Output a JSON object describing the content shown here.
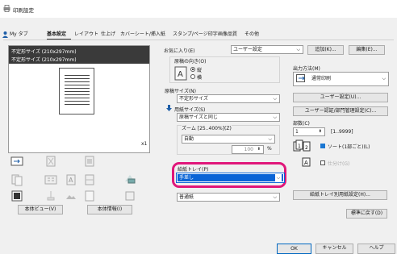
{
  "window": {
    "title": "印刷設定"
  },
  "tabs": [
    "My タブ",
    "基本設定",
    "レイアウト",
    "仕上げ",
    "カバーシート/挿入紙",
    "スタンプ/ページ印字",
    "画像品質",
    "その他"
  ],
  "preview": {
    "line1": "不定形サイズ (210x297mm)",
    "line2": "不定形サイズ (210x297mm)",
    "count": "x1",
    "btn_view": "本体ビュー(V)",
    "btn_info": "本体情報(I)"
  },
  "favorites": {
    "label": "お気に入り(E)",
    "value": "ユーザー設定",
    "add_label": "追加(K)...",
    "edit_label": "編集(E)..."
  },
  "orientation": {
    "label": "原稿の向き(O)",
    "opt_portrait": "縦",
    "opt_landscape": "横",
    "selected": "縦"
  },
  "original_size": {
    "label": "原稿サイズ(N)",
    "value": "不定形サイズ"
  },
  "paper_size": {
    "label": "用紙サイズ(S)",
    "value": "原稿サイズと同じ"
  },
  "zoom": {
    "label": "ズーム [25..400%](Z)",
    "mode": "自動",
    "value": "100",
    "unit": "%"
  },
  "paper_tray": {
    "label": "給紙トレイ(P)",
    "value": "手差し"
  },
  "paper_type": {
    "value": "普通紙"
  },
  "output_method": {
    "label": "出力方法(M)",
    "value": "通常印刷",
    "btn_user_settings": "ユーザー設定(U)...",
    "btn_auth": "ユーザー認証/部門管理設定(C)..."
  },
  "copies": {
    "label": "部数(C)",
    "value": "1",
    "range": "[1..9999]"
  },
  "collate": {
    "label": "ソート(1部ごと)(L)",
    "checked": true
  },
  "offset": {
    "label": "仕分け(G)",
    "checked": false
  },
  "tray_settings_button": "給紙トレイ別用紙設定(H)...",
  "restore_defaults_button": "標準に戻す(D)",
  "footer": {
    "ok": "OK",
    "cancel": "キャンセル",
    "help": "ヘルプ"
  },
  "colors": {
    "accent": "#0a64d6",
    "highlight": "#e0177a",
    "collate_check": "#1976d2"
  }
}
